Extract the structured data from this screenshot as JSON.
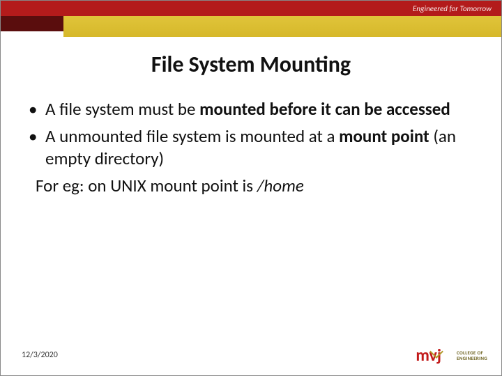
{
  "header": {
    "tagline": "Engineered for Tomorrow"
  },
  "title": "File System Mounting",
  "bullets": {
    "b1_pre": "A file system must be ",
    "b1_bold": "mounted before it can be accessed",
    "b2_pre": "A unmounted file system is mounted at a ",
    "b2_bold": "mount point",
    "b2_post": " (an empty directory)",
    "eg_pre": "For eg: on UNIX mount point is ",
    "eg_italic": "/home"
  },
  "footer": {
    "date": "12/3/2020"
  },
  "logo": {
    "mark": "mvj",
    "line1": "COLLEGE OF",
    "line2": "ENGINEERING"
  }
}
